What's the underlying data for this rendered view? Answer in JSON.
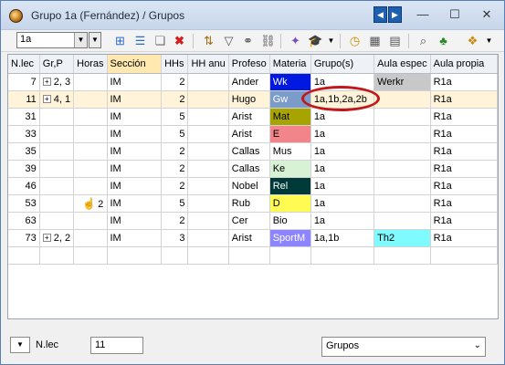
{
  "window": {
    "title": "Grupo 1a (Fernández) / Grupos",
    "nav_prev": "◀",
    "nav_next": "▶",
    "minimize": "—",
    "maximize": "☐",
    "close": "✕"
  },
  "toolbar": {
    "group_value": "1a",
    "icons": [
      "new-lesson-icon",
      "grid-icon",
      "new-doc-icon",
      "delete-icon",
      "sort-icon",
      "filter-icon",
      "couple-icon",
      "link-icon",
      "wand-icon",
      "graduate-icon",
      "clock-icon",
      "grid-view-icon",
      "print-icon",
      "preview-icon",
      "tree-icon",
      "settings-icon"
    ]
  },
  "table": {
    "headers": [
      "N.lec",
      "Gr,P",
      "Horas",
      "Sección",
      "HHs",
      "HH anu",
      "Profeso",
      "Materia",
      "Grupo(s)",
      "Aula espec",
      "Aula propia"
    ],
    "rows": [
      {
        "nlec": "7",
        "gr": "2, 3",
        "horas": "",
        "seccion": "IM",
        "hhs": "2",
        "prof": "Ander",
        "mat": "Wk",
        "grupos": "1a",
        "aula_esp": "Werkr",
        "aula_prop": "R1a"
      },
      {
        "nlec": "11",
        "gr": "4, 1",
        "horas": "",
        "seccion": "IM",
        "hhs": "2",
        "prof": "Hugo",
        "mat": "Gw",
        "grupos": "1a,1b,2a,2b",
        "aula_esp": "",
        "aula_prop": "R1a"
      },
      {
        "nlec": "31",
        "gr": "",
        "horas": "",
        "seccion": "IM",
        "hhs": "5",
        "prof": "Arist",
        "mat": "Mat",
        "grupos": "1a",
        "aula_esp": "",
        "aula_prop": "R1a"
      },
      {
        "nlec": "33",
        "gr": "",
        "horas": "",
        "seccion": "IM",
        "hhs": "5",
        "prof": "Arist",
        "mat": "E",
        "grupos": "1a",
        "aula_esp": "",
        "aula_prop": "R1a"
      },
      {
        "nlec": "35",
        "gr": "",
        "horas": "",
        "seccion": "IM",
        "hhs": "2",
        "prof": "Callas",
        "mat": "Mus",
        "grupos": "1a",
        "aula_esp": "",
        "aula_prop": "R1a"
      },
      {
        "nlec": "39",
        "gr": "",
        "horas": "",
        "seccion": "IM",
        "hhs": "2",
        "prof": "Callas",
        "mat": "Ke",
        "grupos": "1a",
        "aula_esp": "",
        "aula_prop": "R1a"
      },
      {
        "nlec": "46",
        "gr": "",
        "horas": "",
        "seccion": "IM",
        "hhs": "2",
        "prof": "Nobel",
        "mat": "Rel",
        "grupos": "1a",
        "aula_esp": "",
        "aula_prop": "R1a"
      },
      {
        "nlec": "53",
        "gr": "",
        "horas": "2",
        "seccion": "IM",
        "hhs": "5",
        "prof": "Rub",
        "mat": "D",
        "grupos": "1a",
        "aula_esp": "",
        "aula_prop": "R1a"
      },
      {
        "nlec": "63",
        "gr": "",
        "horas": "",
        "seccion": "IM",
        "hhs": "2",
        "prof": "Cer",
        "mat": "Bio",
        "grupos": "1a",
        "aula_esp": "",
        "aula_prop": "R1a"
      },
      {
        "nlec": "73",
        "gr": "2, 2",
        "horas": "",
        "seccion": "IM",
        "hhs": "3",
        "prof": "Arist",
        "mat": "SportM",
        "grupos": "1a,1b",
        "aula_esp": "Th2",
        "aula_prop": "R1a"
      }
    ],
    "subject_colors": {
      "Wk": "#0018e0",
      "Gw": "#7b9cc8",
      "Mat": "#a7a400",
      "E": "#f2858c",
      "Mus": "#ffffff",
      "Ke": "#d8f2d6",
      "Rel": "#003a38",
      "D": "#fffb53",
      "Bio": "#ffffff",
      "SportM": "#8c85ff"
    },
    "subject_text_colors": {
      "Wk": "#ffffff",
      "Gw": "#ffffff",
      "Mat": "#000000",
      "E": "#000000",
      "Mus": "#000000",
      "Ke": "#000000",
      "Rel": "#ffffff",
      "D": "#000000",
      "Bio": "#000000",
      "SportM": "#ffffff"
    },
    "room_colors": {
      "Werkr": "#c8c8c8",
      "Th2": "#7ffbff"
    }
  },
  "bottom": {
    "sort_label": "N.lec",
    "value": "11",
    "view_select": "Grupos"
  }
}
